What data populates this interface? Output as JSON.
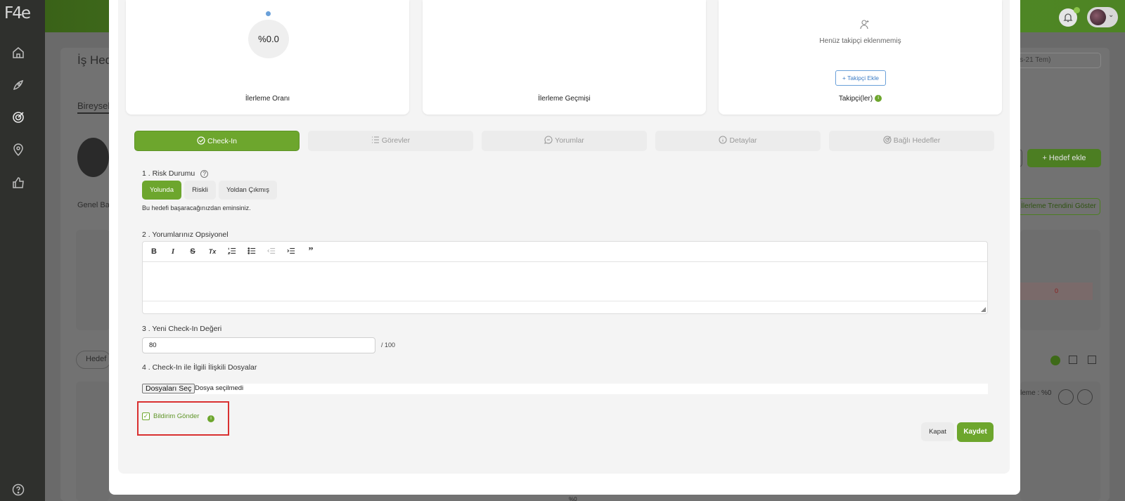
{
  "app": {
    "logo_text": "F4e"
  },
  "background": {
    "page_title": "İş Hed",
    "tab_partial": "Bireysel",
    "genel_partial": "Genel Ba",
    "hedef_partial": "Hedef",
    "date_select": "is-21 Tem)",
    "add_goal_button": "+ Hedef ekle",
    "trend_button": "İlerleme Trendini Göster",
    "zero_value": "0",
    "progress_partial": "leme : %0",
    "bottom_value": "%0"
  },
  "cards": {
    "progress": {
      "value": "%0.0",
      "title": "İlerleme Oranı"
    },
    "history": {
      "title": "İlerleme Geçmişi"
    },
    "followers": {
      "empty_text": "Henüz takipçi eklenmemiş",
      "add_button": "+ Takipçi Ekle",
      "title": "Takipçi(ler)"
    }
  },
  "tabs": [
    {
      "label": "Check-In",
      "icon": "check-circle-icon",
      "active": true
    },
    {
      "label": "Görevler",
      "icon": "list-icon",
      "active": false
    },
    {
      "label": "Yorumlar",
      "icon": "comment-icon",
      "active": false
    },
    {
      "label": "Detaylar",
      "icon": "info-icon",
      "active": false
    },
    {
      "label": "Bağlı Hedefler",
      "icon": "target-icon",
      "active": false
    }
  ],
  "form": {
    "risk": {
      "label": "1 . Risk Durumu",
      "options": [
        "Yolunda",
        "Riskli",
        "Yoldan Çıkmış"
      ],
      "selected": "Yolunda",
      "note": "Bu hedefi başaracağınızdan eminsiniz."
    },
    "comments": {
      "label": "2 . Yorumlarınız Opsiyonel",
      "toolbar": [
        "B",
        "I",
        "S",
        "Tx",
        "ordered-list",
        "bullet-list",
        "outdent",
        "indent",
        "quote"
      ],
      "value": ""
    },
    "checkin_value": {
      "label": "3 . Yeni Check-In Değeri",
      "value": "80",
      "suffix": "/ 100"
    },
    "files": {
      "label": "4 . Check-In ile İlgili İlişkili Dosyalar",
      "button": "Dosyaları Seç",
      "status": "Dosya seçilmedi"
    },
    "notify": {
      "label": "Bildirim Gönder",
      "checked": true
    }
  },
  "actions": {
    "close": "Kapat",
    "save": "Kaydet"
  },
  "colors": {
    "accent": "#6da62d",
    "highlight": "#d93030",
    "link": "#3a7bc5"
  }
}
